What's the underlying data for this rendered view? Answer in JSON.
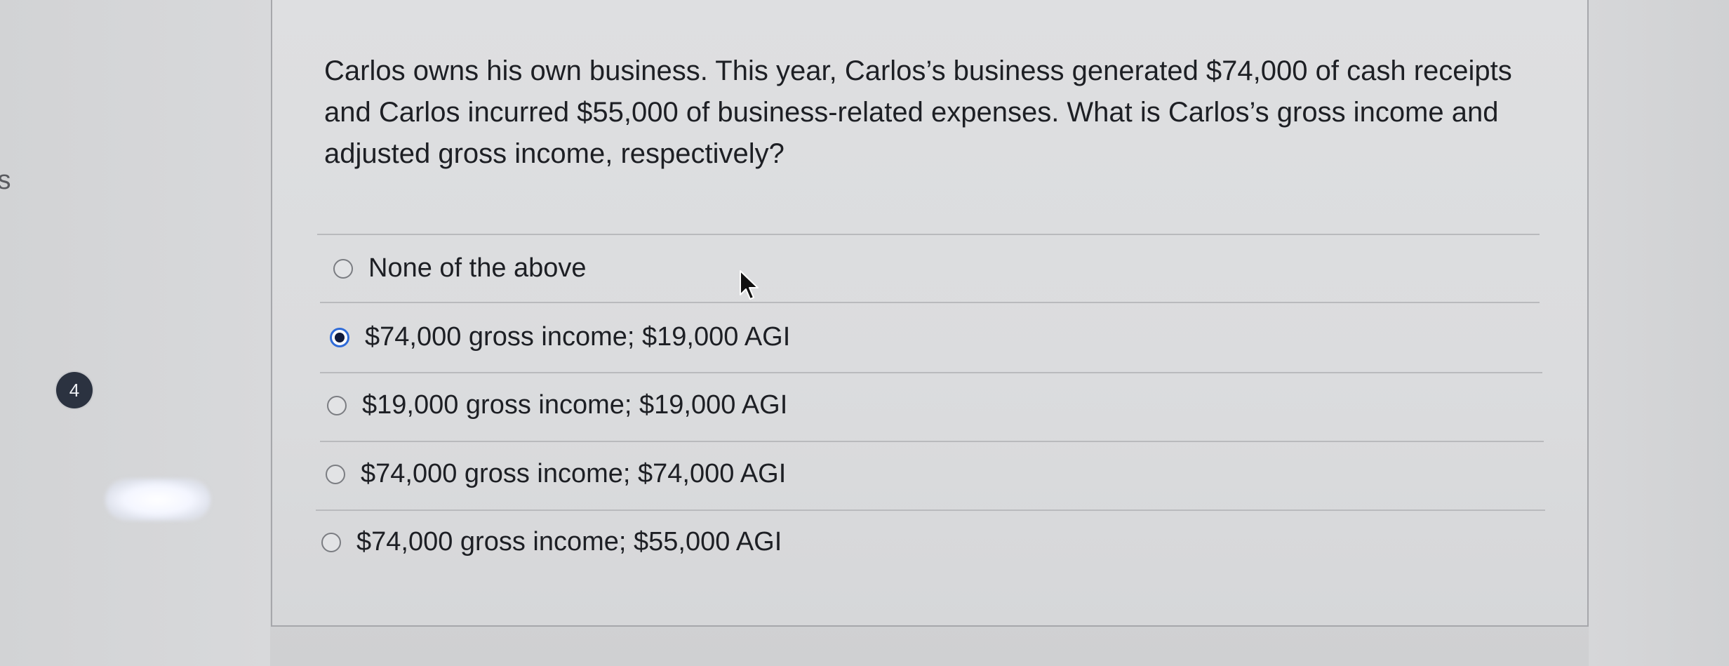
{
  "gutter": {
    "clipped_text": "ts",
    "question_number": "4"
  },
  "question": {
    "text": "Carlos owns his own business. This year, Carlos’s business generated $74,000 of cash receipts and Carlos incurred $55,000 of business-related expenses. What is Carlos’s gross income and adjusted gross income, respectively?"
  },
  "options": [
    {
      "label": "None of the above",
      "selected": false
    },
    {
      "label": "$74,000 gross income; $19,000 AGI",
      "selected": true
    },
    {
      "label": "$19,000 gross income; $19,000 AGI",
      "selected": false
    },
    {
      "label": "$74,000 gross income; $74,000 AGI",
      "selected": false
    },
    {
      "label": "$74,000 gross income; $55,000 AGI",
      "selected": false
    }
  ],
  "colors": {
    "selected_radio": "#2f6bd8",
    "badge": "#2b3240"
  }
}
